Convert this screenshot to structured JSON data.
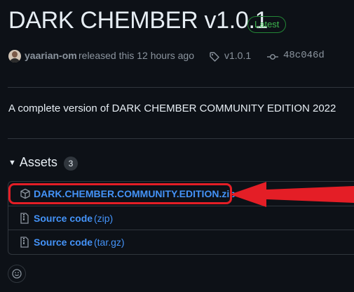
{
  "release": {
    "title": "DARK CHEMBER v1.0.1",
    "badge": "Latest",
    "author": "yaarian-om",
    "released_text": "released this 12 hours ago",
    "tag": "v1.0.1",
    "commit": "48c046d",
    "description": "A complete version of DARK CHEMBER COMMUNITY EDITION 2022"
  },
  "assets": {
    "heading": "Assets",
    "count": "3",
    "items": [
      {
        "name": "DARK.CHEMBER.COMMUNITY.EDITION.zip",
        "suffix": "",
        "icon": "package-icon"
      },
      {
        "name": "Source code",
        "suffix": "(zip)",
        "icon": "file-zip-icon"
      },
      {
        "name": "Source code",
        "suffix": "(tar.gz)",
        "icon": "file-zip-icon"
      }
    ]
  },
  "annotation": {
    "highlight_color": "#e41e26"
  },
  "colors": {
    "background": "#0d1117",
    "link": "#4493f8",
    "latest_badge": "#3fb950",
    "muted": "#8b949e"
  }
}
